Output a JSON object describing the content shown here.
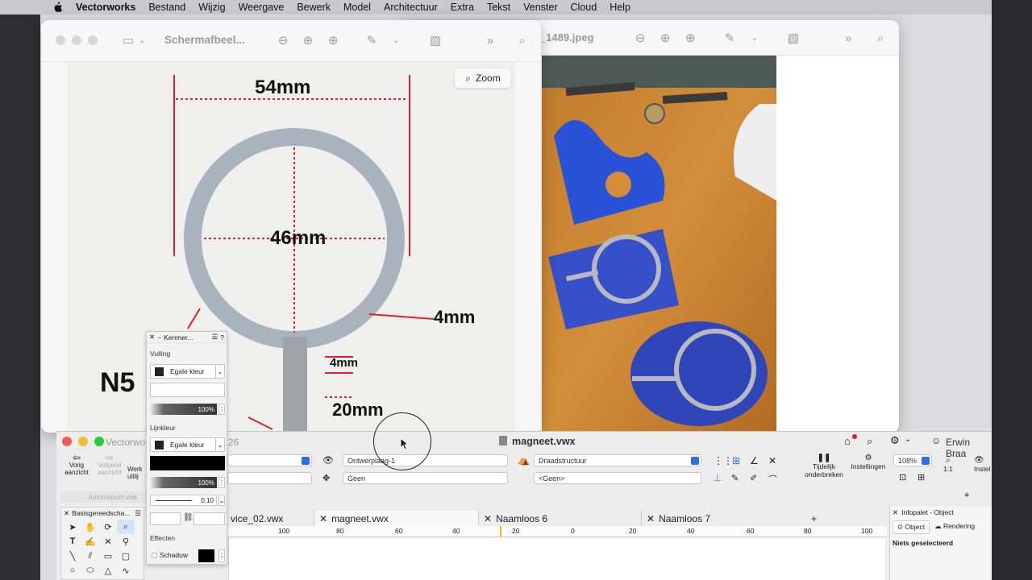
{
  "menu": {
    "items": [
      "Vectorworks",
      "Bestand",
      "Wijzig",
      "Weergave",
      "Bewerk",
      "Model",
      "Architectuur",
      "Extra",
      "Tekst",
      "Venster",
      "Cloud",
      "Help"
    ]
  },
  "preview1": {
    "title": "Schermafbeel...",
    "zoom_label": "Zoom",
    "image_labels": {
      "outer": "54mm",
      "inner": "46mm",
      "ring": "4mm",
      "stem_width": "4mm",
      "stem_length": "20mm",
      "magnet": "N5"
    }
  },
  "preview2": {
    "title": "_1489.jpeg"
  },
  "vectorworks": {
    "app_label": "Vectorwo",
    "partial_number": "26",
    "doc_title": "magneet.vwx",
    "user": "Erwin Braa",
    "nav": {
      "prev": "Vorig aanzicht",
      "next": "Volgend aanzicht",
      "work": "Werk uitlij",
      "auto": "Automatisch vlak"
    },
    "view_bar": {
      "layer": "Ontwerplaag-1",
      "class": "Geen",
      "render": "Draadstructuur",
      "light": "<Geen>",
      "zoom": "108%",
      "scale": "1:1",
      "pause_label": "Tijdelijk onderbreken",
      "settings_label": "Instellingen",
      "settings_partial": "Instel"
    },
    "tabs": [
      "vice_02.vwx",
      "magneet.vwx",
      "Naamloos 6",
      "Naamloos 7"
    ],
    "ruler": [
      "100",
      "80",
      "60",
      "40",
      "20",
      "0",
      "20",
      "40",
      "60",
      "80",
      "100"
    ],
    "tools_title": "Basisgereedscha...",
    "info": {
      "title": "Infopalet - Object",
      "tab_object": "Object",
      "tab_render": "Rendering",
      "empty": "Niets geselecteerd"
    }
  },
  "kenmerken": {
    "title": "Kenmer...",
    "fill_section": "Vulling",
    "fill_type": "Egale kleur",
    "fill_opacity": "100%",
    "line_section": "Lijnkleur",
    "line_type": "Egale kleur",
    "line_opacity": "100%",
    "line_width": "0,10",
    "effects_section": "Effecten",
    "shadow_label": "Schaduw"
  }
}
